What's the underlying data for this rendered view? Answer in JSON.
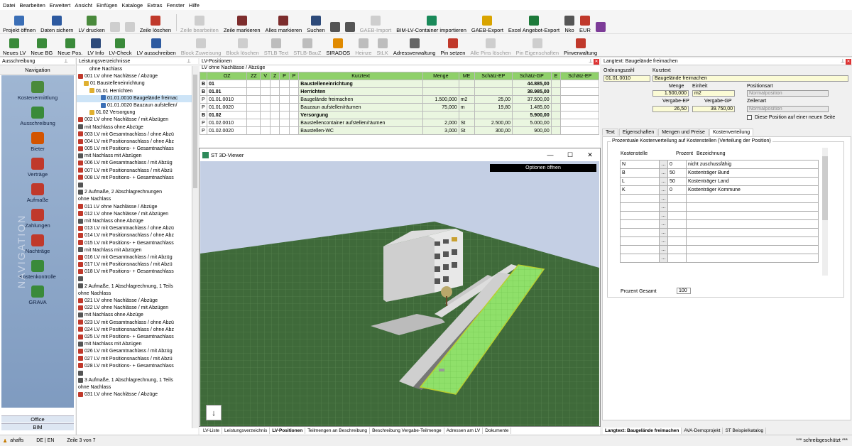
{
  "menu": [
    "Datei",
    "Bearbeiten",
    "Erweitert",
    "Ansicht",
    "Einfügen",
    "Kataloge",
    "Extras",
    "Fenster",
    "Hilfe"
  ],
  "toolbar1": [
    {
      "label": "Projekt öffnen",
      "icon": "folder-open-icon",
      "color": "#3b6fb6",
      "dis": false
    },
    {
      "label": "Daten sichern",
      "icon": "save-icon",
      "color": "#2d5aa0",
      "dis": false
    },
    {
      "label": "LV drucken",
      "icon": "print-icon",
      "color": "#4a8a3c",
      "dis": false
    },
    {
      "label": "",
      "icon": "undo-icon",
      "color": "#888",
      "dis": true
    },
    {
      "label": "",
      "icon": "redo-icon",
      "color": "#888",
      "dis": true
    },
    {
      "label": "Zeile löschen",
      "icon": "delete-row-icon",
      "color": "#c0392b",
      "dis": false
    },
    {
      "label": "Zeile bearbeiten",
      "icon": "edit-row-icon",
      "color": "#888",
      "dis": true
    },
    {
      "label": "Zeile markieren",
      "icon": "mark-row-icon",
      "color": "#7d2d2d",
      "dis": false
    },
    {
      "label": "Alles markieren",
      "icon": "mark-all-icon",
      "color": "#7d2d2d",
      "dis": false
    },
    {
      "label": "Suchen",
      "icon": "binoculars-icon",
      "color": "#2d4a7a",
      "dis": false
    },
    {
      "label": "",
      "icon": "indent-icon",
      "color": "#555",
      "dis": false
    },
    {
      "label": "",
      "icon": "outdent-icon",
      "color": "#555",
      "dis": false
    },
    {
      "label": "GAEB-Import",
      "icon": "gaeb-import-icon",
      "color": "#888",
      "dis": true
    },
    {
      "label": "BIM-LV-Container importieren",
      "icon": "bim-import-icon",
      "color": "#1a8a5a",
      "dis": false
    },
    {
      "label": "GAEB-Export",
      "icon": "gaeb-export-icon",
      "color": "#d9a400",
      "dis": false
    },
    {
      "label": "Excel Angebot-Export",
      "icon": "excel-icon",
      "color": "#1d7a3a",
      "dis": false
    },
    {
      "label": "Nko",
      "icon": "nko-icon",
      "color": "#555",
      "dis": false
    },
    {
      "label": "EUR",
      "icon": "currency-flag-icon",
      "color": "#c0392b",
      "dis": false
    },
    {
      "label": "",
      "icon": "help-icon",
      "color": "#7d3c98",
      "dis": false
    }
  ],
  "toolbar1_currency": "EUR",
  "toolbar1_decimals": "2",
  "toolbar2": [
    {
      "label": "Neues LV",
      "icon": "new-lv-icon",
      "color": "#3a8a3a",
      "dis": false
    },
    {
      "label": "Neue BG",
      "icon": "new-bg-icon",
      "color": "#3a8a3a",
      "dis": false
    },
    {
      "label": "Neue Pos.",
      "icon": "new-pos-icon",
      "color": "#3a8a3a",
      "dis": false
    },
    {
      "label": "LV Info",
      "icon": "info-icon",
      "color": "#2d4a7a",
      "dis": false
    },
    {
      "label": "LV-Check",
      "icon": "check-icon",
      "color": "#3a8a3a",
      "dis": false
    },
    {
      "label": "LV ausschreiben",
      "icon": "tender-icon",
      "color": "#2d5aa0",
      "dis": false
    },
    {
      "label": "Block Zuweisung",
      "icon": "block-assign-icon",
      "color": "#888",
      "dis": true
    },
    {
      "label": "Block löschen",
      "icon": "block-delete-icon",
      "color": "#888",
      "dis": true
    },
    {
      "label": "STLB Text",
      "icon": "stlb-text-icon",
      "color": "#555",
      "dis": true
    },
    {
      "label": "STLB-BauZ",
      "icon": "stlb-bauz-icon",
      "color": "#555",
      "dis": true
    },
    {
      "label": "SIRADOS",
      "icon": "sirados-icon",
      "color": "#e08a00",
      "dis": false
    },
    {
      "label": "Heinze",
      "icon": "heinze-icon",
      "color": "#555",
      "dis": true
    },
    {
      "label": "StLK",
      "icon": "stlk-icon",
      "color": "#555",
      "dis": true
    },
    {
      "label": "Adressverwaltung",
      "icon": "address-book-icon",
      "color": "#666",
      "dis": false
    },
    {
      "label": "Pin setzen",
      "icon": "pin-icon",
      "color": "#c0392b",
      "dis": false
    },
    {
      "label": "Alle Pins löschen",
      "icon": "pins-delete-icon",
      "color": "#888",
      "dis": true
    },
    {
      "label": "Pin Eigenschaften",
      "icon": "pin-properties-icon",
      "color": "#888",
      "dis": true
    },
    {
      "label": "Pinverwaltung",
      "icon": "pin-manage-icon",
      "color": "#c0392b",
      "dis": false
    }
  ],
  "nav": {
    "panel_title": "Ausschreibung",
    "header": "Navigation",
    "items": [
      {
        "label": "Kostenermittlung",
        "icon": "cost-estimate-icon",
        "color": "#4a8a3c"
      },
      {
        "label": "Ausschreibung",
        "icon": "tender-doc-icon",
        "color": "#3a8a3a"
      },
      {
        "label": "Bieter",
        "icon": "bidder-icon",
        "color": "#d35400"
      },
      {
        "label": "Verträge",
        "icon": "contract-icon",
        "color": "#c0392b"
      },
      {
        "label": "Aufmaße",
        "icon": "measurement-icon",
        "color": "#c0392b"
      },
      {
        "label": "Zahlungen",
        "icon": "payment-icon",
        "color": "#c0392b"
      },
      {
        "label": "Nachträge",
        "icon": "supplement-icon",
        "color": "#c0392b"
      },
      {
        "label": "Kostenkontrolle",
        "icon": "cost-control-icon",
        "color": "#3a8a3a"
      },
      {
        "label": "GRAVA",
        "icon": "grava-icon",
        "color": "#3a8a3a"
      }
    ],
    "vertical": "NAVIGATION",
    "office": "Office",
    "bim": "BIM"
  },
  "tree": {
    "title": "Leistungsverzeichnisse",
    "rows": [
      {
        "t": "ohne Nachlass",
        "ind": 18,
        "ic": ""
      },
      {
        "t": "001 LV ohne Nachlässe / Abzüge",
        "ind": 2,
        "ic": "#c0392b"
      },
      {
        "t": "01 Baustelleneinrichtung",
        "ind": 10,
        "ic": "#e0b030"
      },
      {
        "t": "01.01 Herrichten",
        "ind": 18,
        "ic": "#e0b030"
      },
      {
        "t": "01.01.0010 Baugelände freimac",
        "ind": 34,
        "ic": "#3a6fb6",
        "sel": true
      },
      {
        "t": "01.01.0020 Bauzaun aufstellen/",
        "ind": 34,
        "ic": "#3a6fb6"
      },
      {
        "t": "01.02 Versorgung",
        "ind": 18,
        "ic": "#e0b030"
      },
      {
        "t": "002 LV ohne Nachlässe / mit Abzügen",
        "ind": 2,
        "ic": "#c0392b"
      },
      {
        "t": "mit Nachlass ohne Abzüge",
        "ind": 2,
        "ic": "#555"
      },
      {
        "t": "003 LV mit Gesamtnachlass / ohne Abzü",
        "ind": 2,
        "ic": "#c0392b"
      },
      {
        "t": "004 LV mit Positionsnachlass / ohne Abz",
        "ind": 2,
        "ic": "#c0392b"
      },
      {
        "t": "005 LV mit Positions- + Gesamtnachlass",
        "ind": 2,
        "ic": "#c0392b"
      },
      {
        "t": "mit Nachlass mit Abzügen",
        "ind": 2,
        "ic": "#555"
      },
      {
        "t": "006 LV mit Gesamtnachlass / mit Abzüg",
        "ind": 2,
        "ic": "#c0392b"
      },
      {
        "t": "007 LV mit Positionsnachlass / mit Abzü",
        "ind": 2,
        "ic": "#c0392b"
      },
      {
        "t": "008 LV mit Positions- + Gesamtnachlass",
        "ind": 2,
        "ic": "#c0392b"
      },
      {
        "t": "",
        "ind": 2,
        "ic": "#555"
      },
      {
        "t": "2 Aufmaße, 2 Abschlagrechnungen",
        "ind": 2,
        "ic": "#555"
      },
      {
        "t": "ohne Nachlass",
        "ind": 2,
        "ic": ""
      },
      {
        "t": "011 LV ohne Nachlässe / Abzüge",
        "ind": 2,
        "ic": "#c0392b"
      },
      {
        "t": "012 LV ohne Nachlässe / mit Abzügen",
        "ind": 2,
        "ic": "#c0392b"
      },
      {
        "t": "mit Nachlass ohne Abzüge",
        "ind": 2,
        "ic": "#555"
      },
      {
        "t": "013 LV mit Gesamtnachlass / ohne Abzü",
        "ind": 2,
        "ic": "#c0392b"
      },
      {
        "t": "014 LV mit Positionsnachlass / ohne Abz",
        "ind": 2,
        "ic": "#c0392b"
      },
      {
        "t": "015 LV mit Positions- + Gesamtnachlass",
        "ind": 2,
        "ic": "#c0392b"
      },
      {
        "t": "mit Nachlass mit Abzügen",
        "ind": 2,
        "ic": "#555"
      },
      {
        "t": "016 LV mit Gesamtnachlass / mit Abzüg",
        "ind": 2,
        "ic": "#c0392b"
      },
      {
        "t": "017 LV mit Positionsnachlass / mit Abzü",
        "ind": 2,
        "ic": "#c0392b"
      },
      {
        "t": "018 LV mit Positions- + Gesamtnachlass",
        "ind": 2,
        "ic": "#c0392b"
      },
      {
        "t": "",
        "ind": 2,
        "ic": "#555"
      },
      {
        "t": "2 Aufmaße, 1 Abschlagrechnung, 1 Teils",
        "ind": 2,
        "ic": "#555"
      },
      {
        "t": "ohne Nachlass",
        "ind": 2,
        "ic": ""
      },
      {
        "t": "021 LV ohne Nachlässe / Abzüge",
        "ind": 2,
        "ic": "#c0392b"
      },
      {
        "t": "022 LV ohne Nachlässe / mit Abzügen",
        "ind": 2,
        "ic": "#c0392b"
      },
      {
        "t": "mit Nachlass ohne Abzüge",
        "ind": 2,
        "ic": "#555"
      },
      {
        "t": "023 LV mit Gesamtnachlass / ohne Abzü",
        "ind": 2,
        "ic": "#c0392b"
      },
      {
        "t": "024 LV mit Positionsnachlass / ohne Abz",
        "ind": 2,
        "ic": "#c0392b"
      },
      {
        "t": "025 LV mit Positions- + Gesamtnachlass",
        "ind": 2,
        "ic": "#c0392b"
      },
      {
        "t": "mit Nachlass mit Abzügen",
        "ind": 2,
        "ic": "#555"
      },
      {
        "t": "026 LV mit Gesamtnachlass / mit Abzüg",
        "ind": 2,
        "ic": "#c0392b"
      },
      {
        "t": "027 LV mit Positionsnachlass / mit Abzü",
        "ind": 2,
        "ic": "#c0392b"
      },
      {
        "t": "028 LV mit Positions- + Gesamtnachlass",
        "ind": 2,
        "ic": "#c0392b"
      },
      {
        "t": "",
        "ind": 2,
        "ic": "#555"
      },
      {
        "t": "3 Aufmaße, 1 Abschlagrechnung, 1 Teils",
        "ind": 2,
        "ic": "#555"
      },
      {
        "t": "ohne Nachlass",
        "ind": 2,
        "ic": ""
      },
      {
        "t": "031 LV ohne Nachlässe / Abzüge",
        "ind": 2,
        "ic": "#c0392b"
      }
    ]
  },
  "lv": {
    "title": "LV-Positionen",
    "subtitle": "LV ohne Nachlässe / Abzüge",
    "cols": [
      "OZ",
      "ZZ",
      "V",
      "Z",
      "P",
      "P",
      "Kurztext",
      "Menge",
      "ME",
      "Schätz-EP",
      "Schätz-GP",
      "E",
      "Schätz-EP"
    ],
    "rows": [
      {
        "k": "B",
        "oz": "01",
        "txt": "Baustelleneinrichtung",
        "menge": "",
        "me": "",
        "ep": "",
        "gp": "44.885,00",
        "bold": true
      },
      {
        "k": "B",
        "oz": "01.01",
        "txt": "Herrichten",
        "menge": "",
        "me": "",
        "ep": "",
        "gp": "38.985,00",
        "bold": true
      },
      {
        "k": "P",
        "oz": "01.01.0010",
        "txt": "Baugelände freimachen",
        "menge": "1.500,000",
        "me": "m2",
        "ep": "25,00",
        "gp": "37.500,00",
        "bold": false
      },
      {
        "k": "P",
        "oz": "01.01.0020",
        "txt": "Bauzaun aufstellen/räumen",
        "menge": "75,000",
        "me": "m",
        "ep": "19,80",
        "gp": "1.485,00",
        "bold": false
      },
      {
        "k": "B",
        "oz": "01.02",
        "txt": "Versorgung",
        "menge": "",
        "me": "",
        "ep": "",
        "gp": "5.900,00",
        "bold": true
      },
      {
        "k": "P",
        "oz": "01.02.0010",
        "txt": "Baustellencontainer aufstellen/räumen",
        "menge": "2,000",
        "me": "St",
        "ep": "2.500,00",
        "gp": "5.000,00",
        "bold": false
      },
      {
        "k": "P",
        "oz": "01.02.0020",
        "txt": "Baustellen-WC",
        "menge": "3,000",
        "me": "St",
        "ep": "300,00",
        "gp": "900,00",
        "bold": false
      }
    ]
  },
  "viewer": {
    "title": "ST 3D-Viewer",
    "options": "Optionen öffnen",
    "min": "—",
    "max": "☐",
    "close": "✕"
  },
  "rp": {
    "title": "Langtext: Baugelände freimachen",
    "ordnungszahl_label": "Ordnungszahl",
    "ordnungszahl": "01.01.0010",
    "kurztext_label": "Kurztext",
    "kurztext": "Baugelände freimachen",
    "menge_label": "Menge",
    "menge": "1.500,000",
    "einheit_label": "Einheit",
    "einheit": "m2",
    "vep_label": "Vergabe-EP",
    "vep": "26,50",
    "vgp_label": "Vergabe-GP",
    "vgp": "39.750,00",
    "positionsart_label": "Positionsart",
    "positionsart": "Normalposition",
    "zeilenart_label": "Zeilenart",
    "zeilenart": "Normalposition",
    "neue_seite": "Diese Position auf einer neuen Seite",
    "tabs": [
      "Text",
      "Eigenschaften",
      "Mengen und Preise",
      "Kostenverteilung"
    ],
    "kv_title": "Prozentuale Kostenverteilung auf Kostenstellen (Verteilung der Position)",
    "kv_cols": [
      "Kostenstelle",
      "Prozent",
      "Bezeichnung"
    ],
    "kv_rows": [
      {
        "ks": "N",
        "p": "0",
        "b": "nicht zuschussfähig"
      },
      {
        "ks": "B",
        "p": "50",
        "b": "Kostenträger Bund"
      },
      {
        "ks": "L",
        "p": "50",
        "b": "Kostenträger Land"
      },
      {
        "ks": "K",
        "p": "0",
        "b": "Kostenträger Kommune"
      }
    ],
    "kv_empty_rows": 8,
    "prozent_gesamt_label": "Prozent Gesamt",
    "prozent_gesamt": "100",
    "btabs": [
      "Langtext: Baugelände freimachen",
      "AVA-Demoprojekt",
      "ST Beispielkatalog"
    ]
  },
  "lv_btabs": [
    "LV-Liste",
    "Leistungsverzeichnis",
    "LV-Positionen",
    "Teilmengen an Beschreibung",
    "Beschreibung Vergabe-Teilmenge",
    "Adressen am LV",
    "Dokumente"
  ],
  "status": {
    "user": "ahaffs",
    "lang": "DE | EN",
    "row": "Zeile 3 von 7",
    "protect": "*** schreibgeschützt ***"
  }
}
